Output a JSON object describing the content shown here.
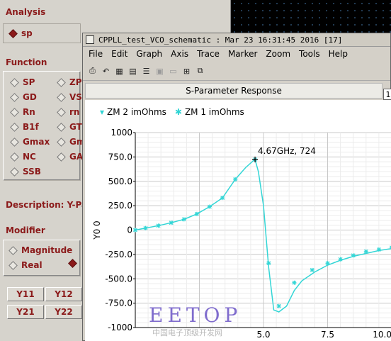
{
  "panel": {
    "analysis_label": "Analysis",
    "analysis_value": "sp",
    "function_label": "Function",
    "functions_col1": [
      "SP",
      "GD",
      "Rn",
      "B1f",
      "Gmax",
      "NC",
      "SSB"
    ],
    "functions_col2": [
      "ZP",
      "VS",
      "rn",
      "GT",
      "Gm",
      "GA"
    ],
    "description": "Description: Y-Par",
    "modifier_label": "Modifier",
    "modifiers": [
      "Magnitude",
      "Real"
    ],
    "y_buttons": [
      "Y11",
      "Y12",
      "Y21",
      "Y22"
    ]
  },
  "window": {
    "title": "CPPLL_test_VCO_schematic : Mar 23 16:31:45 2016 [17]",
    "menu": [
      "File",
      "Edit",
      "Graph",
      "Axis",
      "Trace",
      "Marker",
      "Zoom",
      "Tools",
      "Help"
    ],
    "plot_title": "S-Parameter Response",
    "tab_number": "1"
  },
  "legend": [
    {
      "symbol": "▾",
      "label": "ZM 2 imOhms"
    },
    {
      "symbol": "✱",
      "label": "ZM 1 imOhms"
    }
  ],
  "colors": {
    "trace": "#33d6d6",
    "accent": "#8b1a1a",
    "grid": "#cccccc"
  },
  "watermark": {
    "text": "EETOP",
    "sub": "中国电子顶级开发网"
  },
  "chart_data": {
    "type": "line",
    "title": "S-Parameter Response",
    "xlabel": "",
    "ylabel": "Y0 0",
    "xlim": [
      0,
      10
    ],
    "ylim": [
      -1000,
      1000
    ],
    "y_ticks": [
      "1000",
      "750.0",
      "500.0",
      "250.0",
      "0",
      "-250.0",
      "-500.0",
      "-750.0",
      "-1000"
    ],
    "x_ticks": [
      "5.0",
      "7.5",
      "10.0"
    ],
    "series": [
      {
        "name": "ZM 2 imOhms",
        "x": [
          0,
          0.4,
          0.9,
          1.4,
          1.9,
          2.4,
          2.9,
          3.4,
          3.9,
          4.3,
          4.6,
          4.67,
          4.8,
          5.0,
          5.2,
          5.4,
          5.6,
          5.9,
          6.2,
          6.5,
          7.0,
          7.5,
          8.0,
          8.5,
          9.0,
          9.5,
          10.0
        ],
        "y": [
          0,
          20,
          45,
          75,
          110,
          165,
          240,
          330,
          520,
          640,
          710,
          724,
          600,
          250,
          -380,
          -820,
          -840,
          -780,
          -620,
          -520,
          -430,
          -360,
          -310,
          -270,
          -240,
          -210,
          -190
        ]
      },
      {
        "name": "ZM 1 imOhms",
        "x": [
          0,
          0.4,
          0.9,
          1.4,
          1.9,
          2.4,
          2.9,
          3.4,
          3.9,
          4.67,
          5.2,
          5.6,
          6.2,
          6.9,
          7.5,
          8.0,
          8.5,
          9.0,
          9.5,
          10.0
        ],
        "y": [
          0,
          20,
          45,
          75,
          110,
          165,
          240,
          330,
          520,
          724,
          -340,
          -780,
          -540,
          -410,
          -340,
          -300,
          -260,
          -220,
          -200,
          -180
        ]
      }
    ],
    "marker": {
      "x": 4.67,
      "y": 724,
      "label": "4.67GHz, 724"
    }
  }
}
